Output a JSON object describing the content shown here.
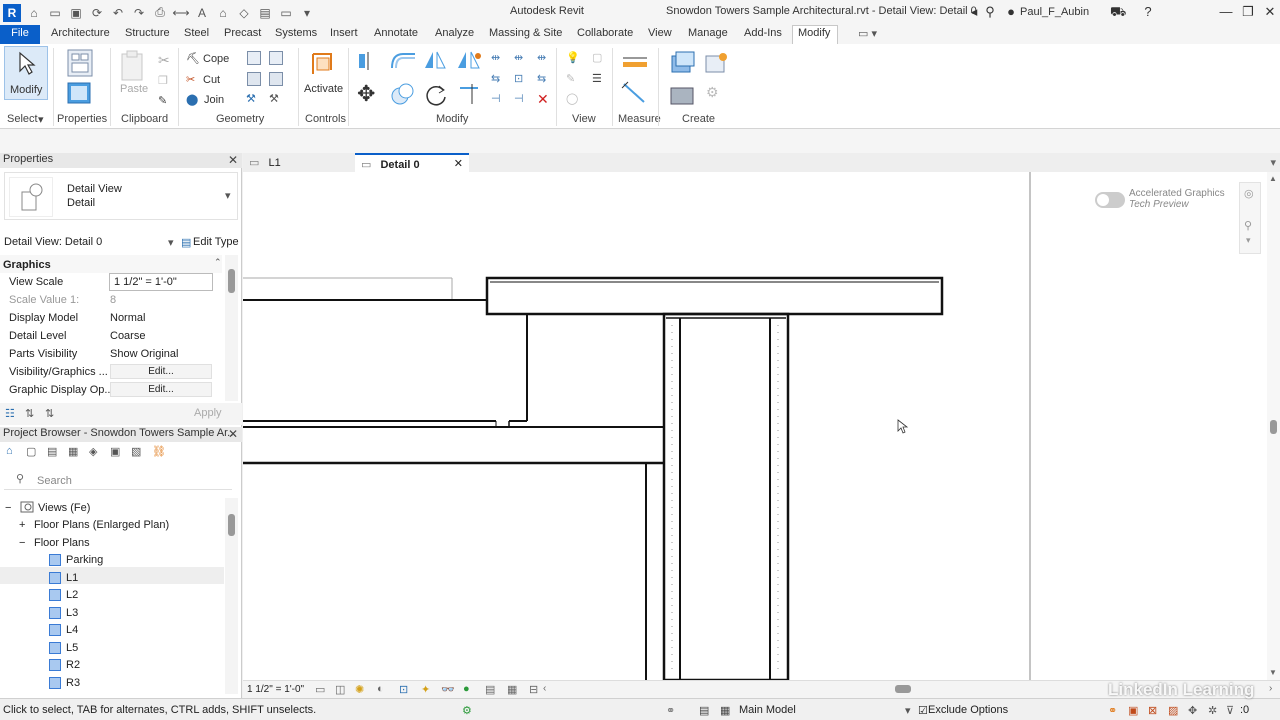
{
  "titlebar": {
    "app_title": "Autodesk Revit",
    "doc_title": "Snowdon Towers Sample Architectural.rvt - Detail View: Detail 0",
    "user": "Paul_F_Aubin"
  },
  "ribbon_tabs": [
    "File",
    "Architecture",
    "Structure",
    "Steel",
    "Precast",
    "Systems",
    "Insert",
    "Annotate",
    "Analyze",
    "Massing & Site",
    "Collaborate",
    "View",
    "Manage",
    "Add-Ins",
    "Modify"
  ],
  "ribbon": {
    "modify_label": "Modify",
    "paste_label": "Paste",
    "cope_label": "Cope",
    "cut_label": "Cut",
    "join_label": "Join",
    "activate_label": "Activate",
    "panels": {
      "select": "Select",
      "properties": "Properties",
      "clipboard": "Clipboard",
      "geometry": "Geometry",
      "controls": "Controls",
      "modify": "Modify",
      "view": "View",
      "measure": "Measure",
      "create": "Create"
    }
  },
  "properties": {
    "title": "Properties",
    "type_name": "Detail View",
    "type_sub": "Detail",
    "selector": "Detail View: Detail 0",
    "edit_type": "Edit Type",
    "section": "Graphics",
    "rows": [
      {
        "name": "View Scale",
        "value": "1 1/2\" = 1'-0\""
      },
      {
        "name": "Scale Value    1:",
        "value": "8"
      },
      {
        "name": "Display Model",
        "value": "Normal"
      },
      {
        "name": "Detail Level",
        "value": "Coarse"
      },
      {
        "name": "Parts Visibility",
        "value": "Show Original"
      },
      {
        "name": "Visibility/Graphics ...",
        "value": "Edit..."
      },
      {
        "name": "Graphic Display Op...",
        "value": "Edit..."
      }
    ],
    "apply": "Apply"
  },
  "browser": {
    "title": "Project Browser - Snowdon Towers Sample Ar...",
    "search_placeholder": "Search",
    "items": [
      {
        "label": "Views (Fe)",
        "level": 0,
        "toggle": "−"
      },
      {
        "label": "Floor Plans (Enlarged Plan)",
        "level": 1,
        "toggle": "+"
      },
      {
        "label": "Floor Plans",
        "level": 1,
        "toggle": "−"
      },
      {
        "label": "Parking",
        "level": 2
      },
      {
        "label": "L1",
        "level": 2
      },
      {
        "label": "L2",
        "level": 2
      },
      {
        "label": "L3",
        "level": 2
      },
      {
        "label": "L4",
        "level": 2
      },
      {
        "label": "L5",
        "level": 2
      },
      {
        "label": "R2",
        "level": 2
      },
      {
        "label": "R3",
        "level": 2
      }
    ]
  },
  "doc_tabs": [
    {
      "label": "L1"
    },
    {
      "label": "Detail 0"
    }
  ],
  "canvas": {
    "accel_line1": "Accelerated Graphics",
    "accel_line2": "Tech Preview"
  },
  "viewbar": {
    "scale": "1 1/2\" = 1'-0\""
  },
  "status": {
    "hint": "Click to select, TAB for alternates, CTRL adds, SHIFT unselects.",
    "model": "Main Model",
    "exclude": "Exclude Options",
    "filter_count": ":0"
  },
  "watermark": "LinkedIn Learning"
}
